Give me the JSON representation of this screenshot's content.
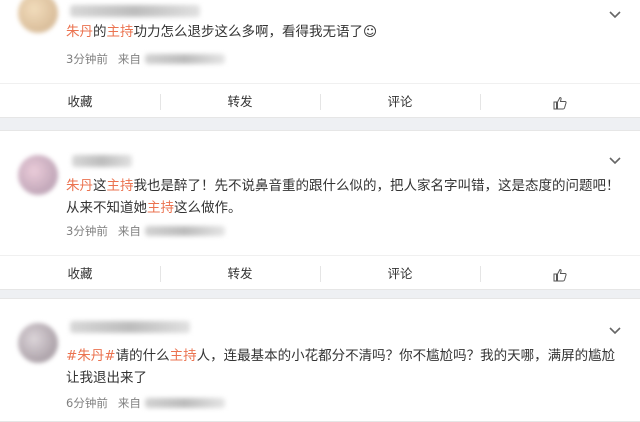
{
  "posts": [
    {
      "segments": [
        {
          "text": "朱丹",
          "hl": true
        },
        {
          "text": "的",
          "hl": false
        },
        {
          "text": "主持",
          "hl": true
        },
        {
          "text": "功力怎么退步这么多啊，看得我无语了☺",
          "hl": false
        }
      ],
      "time": "3分钟前",
      "source_label": "来自"
    },
    {
      "segments": [
        {
          "text": "朱丹",
          "hl": true
        },
        {
          "text": "这",
          "hl": false
        },
        {
          "text": "主持",
          "hl": true
        },
        {
          "text": "我也是醉了！先不说鼻音重的跟什么似的，把人家名字叫错，这是态度的问题吧！从来不知道她",
          "hl": false
        },
        {
          "text": "主持",
          "hl": true
        },
        {
          "text": "这么做作。",
          "hl": false
        }
      ],
      "time": "3分钟前",
      "source_label": "来自"
    },
    {
      "segments": [
        {
          "text": "#朱丹#",
          "hl": true
        },
        {
          "text": "请的什么",
          "hl": false
        },
        {
          "text": "主持",
          "hl": true
        },
        {
          "text": "人，连最基本的小花都分不清吗？你不尴尬吗？我的天哪，满屏的尴尬让我退出来了",
          "hl": false
        }
      ],
      "time": "6分钟前",
      "source_label": "来自"
    }
  ],
  "actions": {
    "favorite": "收藏",
    "repost": "转发",
    "comment": "评论"
  },
  "icons": {
    "menu": "chevron-down-icon",
    "like": "thumbs-up-icon"
  },
  "colors": {
    "highlight": "#eb7350",
    "background": "#eef0f3"
  }
}
